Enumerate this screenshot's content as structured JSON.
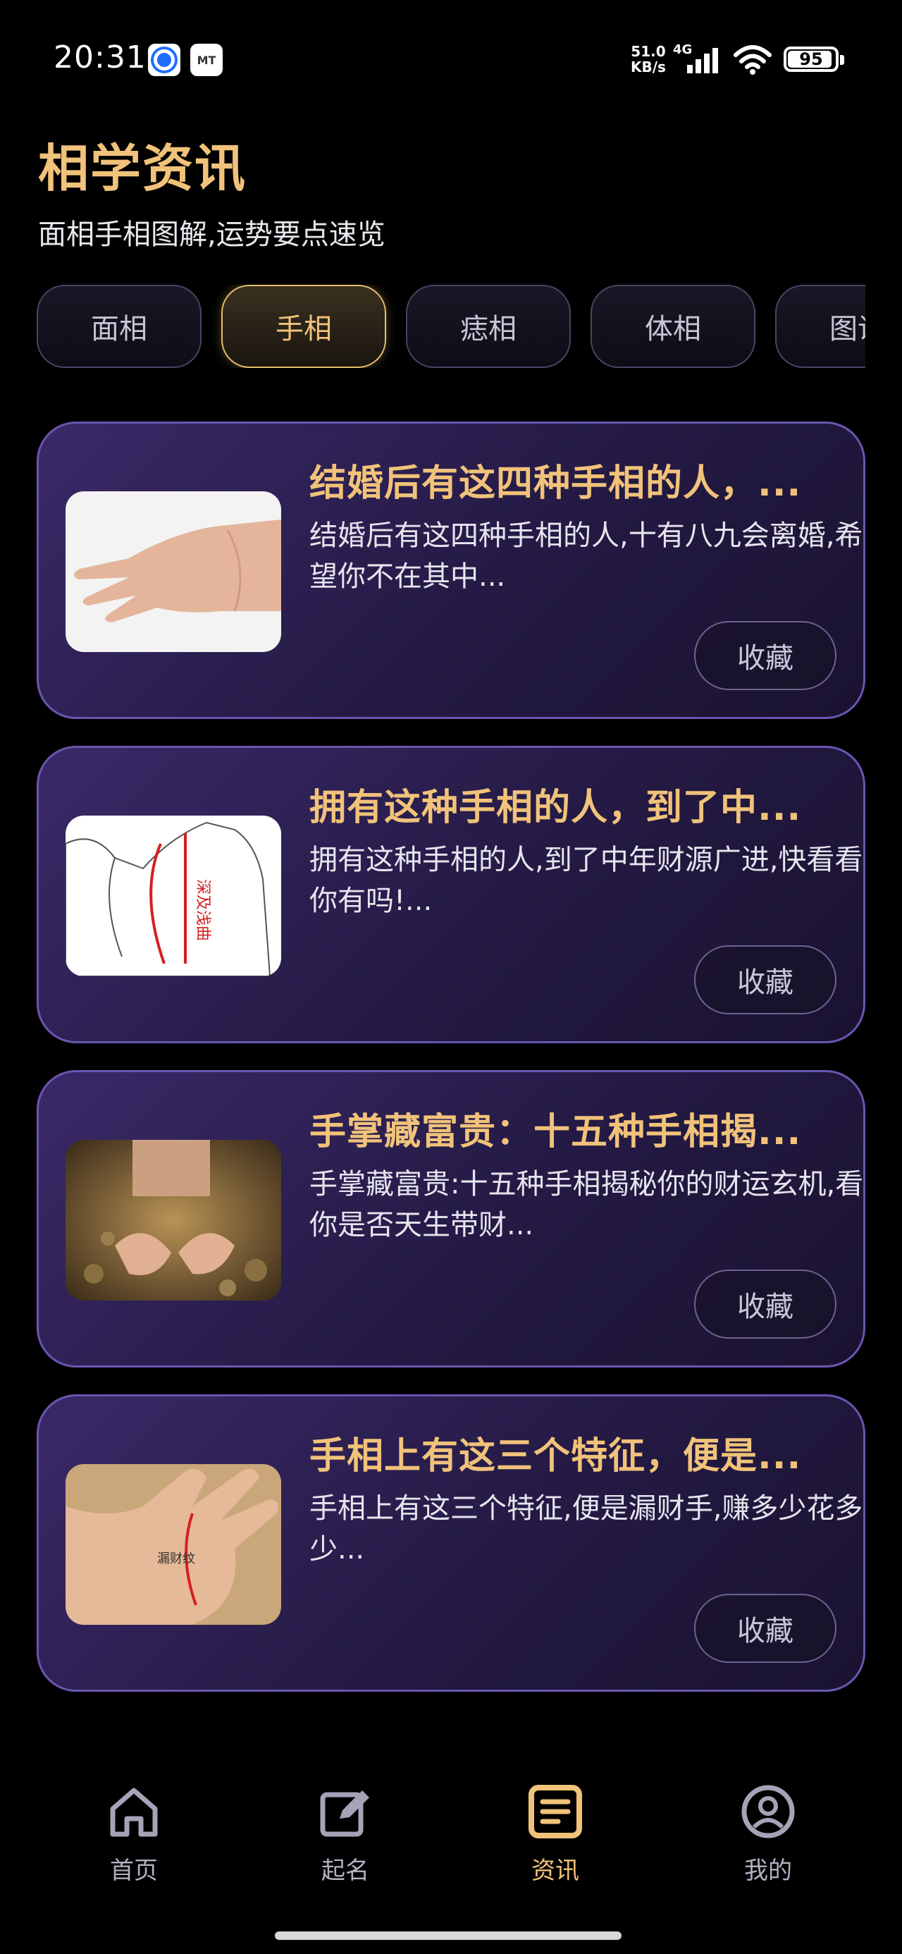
{
  "status_bar": {
    "time": "20:31",
    "net_speed_value": "51.0",
    "net_speed_unit": "KB/s",
    "network_type": "4G",
    "battery": "95",
    "icons": [
      "app-notification-icon",
      "mt-app-icon",
      "signal-icon",
      "wifi-icon",
      "battery-icon"
    ]
  },
  "header": {
    "title": "相学资讯",
    "subtitle": "面相手相图解,运势要点速览"
  },
  "tabs": [
    {
      "label": "面相",
      "active": false
    },
    {
      "label": "手相",
      "active": true
    },
    {
      "label": "痣相",
      "active": false
    },
    {
      "label": "体相",
      "active": false
    },
    {
      "label": "图说",
      "active": false
    }
  ],
  "articles": [
    {
      "title": "结婚后有这四种手相的人，...",
      "desc": "结婚后有这四种手相的人,十有八九会离婚,希望你不在其中...",
      "fav_label": "收藏"
    },
    {
      "title": "拥有这种手相的人，到了中...",
      "desc": "拥有这种手相的人,到了中年财源广进,快看看你有吗!...",
      "fav_label": "收藏",
      "image_text": "深及浅曲"
    },
    {
      "title": "手掌藏富贵：十五种手相揭...",
      "desc": "手掌藏富贵:十五种手相揭秘你的财运玄机,看你是否天生带财...",
      "fav_label": "收藏"
    },
    {
      "title": "手相上有这三个特征，便是...",
      "desc": "手相上有这三个特征,便是漏财手,赚多少花多少...",
      "fav_label": "收藏",
      "image_text": "漏财纹"
    }
  ],
  "bottom_nav": [
    {
      "label": "首页",
      "icon": "home-icon",
      "active": false
    },
    {
      "label": "起名",
      "icon": "edit-icon",
      "active": false
    },
    {
      "label": "资讯",
      "icon": "news-icon",
      "active": true
    },
    {
      "label": "我的",
      "icon": "user-icon",
      "active": false
    }
  ],
  "colors": {
    "accent_gold": "#f1c27a",
    "card_border": "#6a55b0",
    "background": "#000000"
  }
}
